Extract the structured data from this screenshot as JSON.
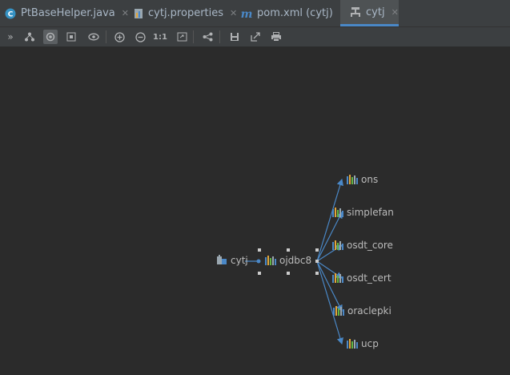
{
  "tabs": [
    {
      "label": "PtBaseHelper.java",
      "icon": "java-class-icon"
    },
    {
      "label": "cytj.properties",
      "icon": "properties-file-icon"
    },
    {
      "label": "pom.xml (cytj)",
      "icon": "maven-icon"
    },
    {
      "label": "cytj",
      "icon": "diagram-icon",
      "active": true
    }
  ],
  "toolbar": {
    "zoom_actual_label": "1:1"
  },
  "graph": {
    "root": "cytj",
    "hub": "ojdbc8",
    "children": [
      "ons",
      "simplefan",
      "osdt_core",
      "osdt_cert",
      "oraclepki",
      "ucp"
    ]
  },
  "colors": {
    "edge": "#4a88c7",
    "active_tab_underline": "#4a88c7"
  }
}
